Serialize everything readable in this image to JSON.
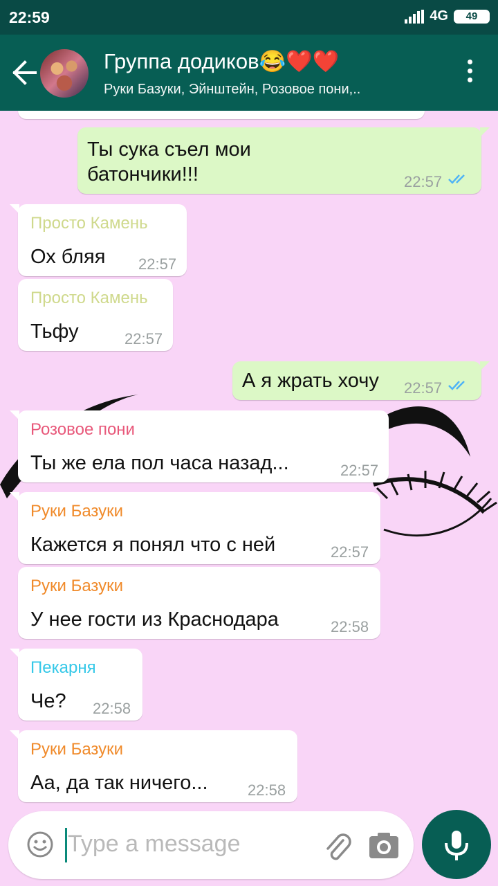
{
  "status_bar": {
    "time": "22:59",
    "network": "4G",
    "battery": "49"
  },
  "header": {
    "title": "Группа додиков😂❤️❤️",
    "subtitle": "Руки Базуки, Эйнштейн, Розовое пони,.."
  },
  "messages": [
    {
      "direction": "out",
      "text_line1": "Ты сука съел мои",
      "text_line2": "батончики!!!",
      "time": "22:57",
      "status": "read"
    },
    {
      "direction": "in",
      "sender": "Просто Камень",
      "text": "Ох бляя",
      "time": "22:57"
    },
    {
      "direction": "in",
      "sender": "Просто Камень",
      "text": "Тьфу",
      "time": "22:57"
    },
    {
      "direction": "out",
      "text": "А я жрать хочу",
      "time": "22:57",
      "status": "read"
    },
    {
      "direction": "in",
      "sender": "Розовое пони",
      "text": "Ты же ела пол часа назад...",
      "time": "22:57"
    },
    {
      "direction": "in",
      "sender": "Руки Базуки",
      "text": "Кажется я понял что с ней",
      "time": "22:57"
    },
    {
      "direction": "in",
      "sender": "Руки Базуки",
      "text": "У нее гости из Краснодара",
      "time": "22:58"
    },
    {
      "direction": "in",
      "sender": "Пекарня",
      "text": "Че?",
      "time": "22:58"
    },
    {
      "direction": "in",
      "sender": "Руки Базуки",
      "text": "Аа, да так ничего...",
      "time": "22:58"
    }
  ],
  "input": {
    "placeholder": "Type a message"
  },
  "colors": {
    "header": "#075e54",
    "status_bar": "#094a45",
    "chat_background": "#f9d5f7",
    "outgoing_bubble": "#dcf8c6",
    "sender_prosto_kamen": "#cfd98c",
    "sender_rozovoe_poni": "#e8587a",
    "sender_ruki_bazuki": "#f08a2a",
    "sender_pekarnya": "#35c8e8",
    "read_ticks": "#4fb3f6"
  },
  "icons": [
    "back-arrow-icon",
    "group-avatar",
    "more-vert-icon",
    "read-ticks-icon",
    "emoji-icon",
    "attach-icon",
    "camera-icon",
    "mic-icon"
  ]
}
